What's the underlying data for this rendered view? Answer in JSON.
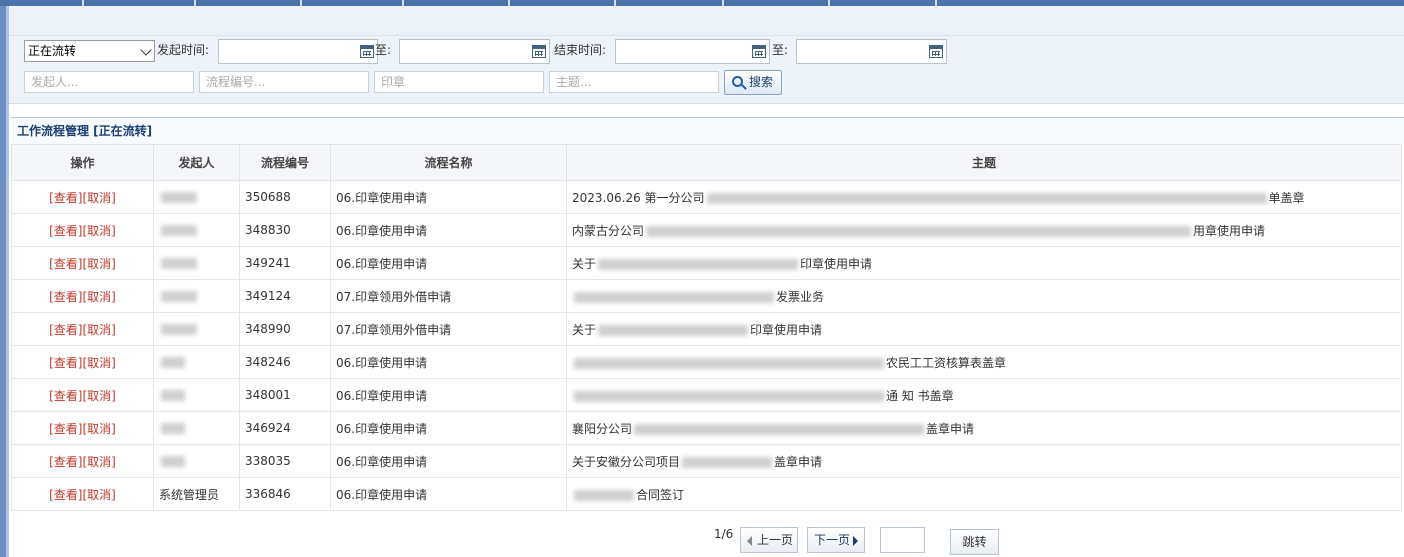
{
  "filters": {
    "status_select": "正在流转",
    "start_time_label": "发起时间:",
    "to_label_1": "至:",
    "end_time_label": "结束时间:",
    "to_label_2": "至:",
    "initiator_placeholder": "发起人...",
    "process_no_placeholder": "流程编号...",
    "seal_placeholder": "印章",
    "subject_placeholder": "主题...",
    "search_label": "搜索"
  },
  "panel": {
    "title": "工作流程管理 [正在流转]"
  },
  "table": {
    "columns": [
      "操作",
      "发起人",
      "流程编号",
      "流程名称",
      "主题"
    ],
    "view_label": "[查看]",
    "cancel_label": "[取消]",
    "rows": [
      {
        "initiator": "",
        "number": "350688",
        "name": "06.印章使用申请",
        "subject_pre": "2023.06.26 第一分公司",
        "subject_post": "单盖章"
      },
      {
        "initiator": "",
        "number": "348830",
        "name": "06.印章使用申请",
        "subject_pre": "内蒙古分公司",
        "subject_post": "用章使用申请"
      },
      {
        "initiator": "",
        "number": "349241",
        "name": "06.印章使用申请",
        "subject_pre": "关于",
        "subject_post": "印章使用申请"
      },
      {
        "initiator": "",
        "number": "349124",
        "name": "07.印章领用外借申请",
        "subject_pre": "",
        "subject_post": "发票业务"
      },
      {
        "initiator": "",
        "number": "348990",
        "name": "07.印章领用外借申请",
        "subject_pre": "关于",
        "subject_post": "印章使用申请"
      },
      {
        "initiator": "",
        "number": "348246",
        "name": "06.印章使用申请",
        "subject_pre": "",
        "subject_post": "农民工工资核算表盖章"
      },
      {
        "initiator": "",
        "number": "348001",
        "name": "06.印章使用申请",
        "subject_pre": "",
        "subject_post": "通 知 书盖章"
      },
      {
        "initiator": "",
        "number": "346924",
        "name": "06.印章使用申请",
        "subject_pre": "襄阳分公司",
        "subject_post": "盖章申请"
      },
      {
        "initiator": "",
        "number": "338035",
        "name": "06.印章使用申请",
        "subject_pre": "关于安徽分公司项目",
        "subject_post": "盖章申请"
      },
      {
        "initiator": "系统管理员",
        "number": "336846",
        "name": "06.印章使用申请",
        "subject_pre": "",
        "subject_post": "合同签订"
      }
    ]
  },
  "pager": {
    "page_info": "1/6",
    "prev_label": "上一页",
    "next_label": "下一页",
    "jump_label": "跳转"
  }
}
